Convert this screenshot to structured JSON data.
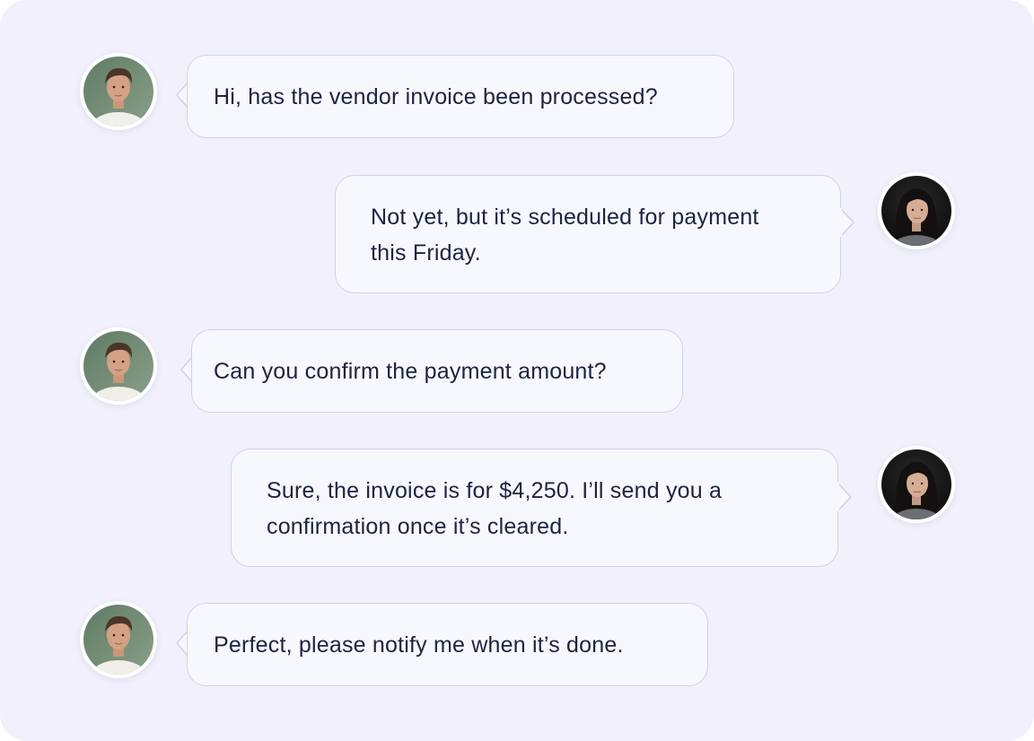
{
  "messages": [
    {
      "sender": "left",
      "avatar": "male-avatar",
      "text": "Hi, has the vendor invoice been processed?"
    },
    {
      "sender": "right",
      "avatar": "female-avatar",
      "text": "Not yet, but it’s scheduled for payment\nthis Friday."
    },
    {
      "sender": "left",
      "avatar": "male-avatar",
      "text": "Can you confirm the payment amount?"
    },
    {
      "sender": "right",
      "avatar": "female-avatar",
      "text": "Sure, the invoice is for $4,250. I’ll send you a\nconfirmation once it’s cleared."
    },
    {
      "sender": "left",
      "avatar": "male-avatar",
      "text": "Perfect, please notify me when it’s done."
    }
  ],
  "colors": {
    "background": "#f1f0fc",
    "bubble": "#f7f7fe",
    "bubble_border": "#cfd2ea",
    "text": "#1c2440"
  }
}
